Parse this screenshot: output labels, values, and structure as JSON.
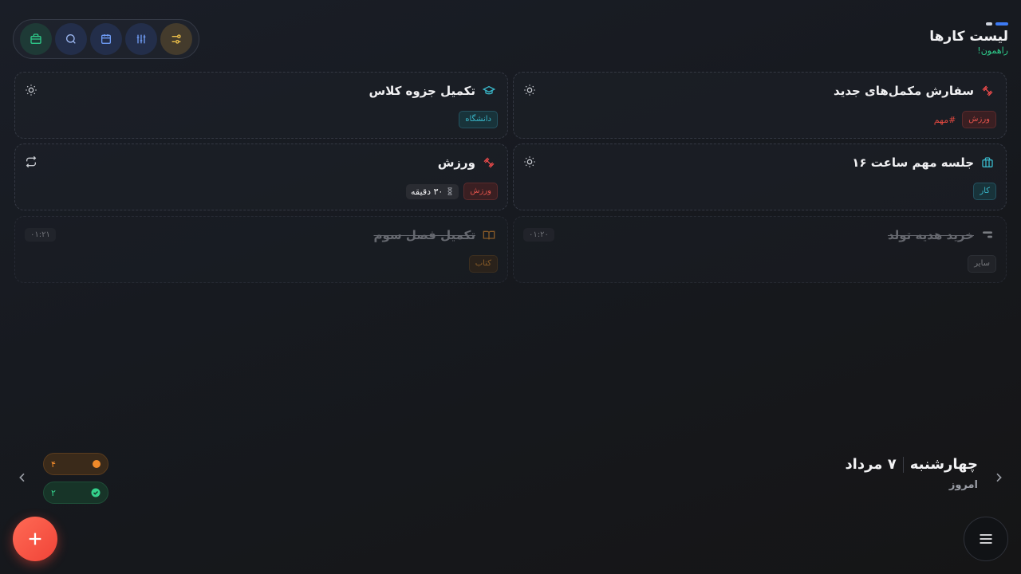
{
  "header": {
    "title": "لیست کارها",
    "subtitle": "راهمون!"
  },
  "toolbar": {
    "icons": [
      "briefcase-icon",
      "search-icon",
      "calendar-icon",
      "sliders-icon",
      "filter-toggle-icon"
    ]
  },
  "tasks": [
    {
      "title": "سفارش مکمل‌های جدید",
      "icon": "dumbbell-icon",
      "tags": [
        "ورزش"
      ],
      "hashtag": "#مهم",
      "action": "sun-icon"
    },
    {
      "title": "تکمیل جزوه کلاس",
      "icon": "graduation-cap-icon",
      "tags": [
        "دانشگاه"
      ],
      "action": "sun-icon"
    },
    {
      "title": "جلسه مهم ساعت ۱۶",
      "icon": "briefcase-icon",
      "tags": [
        "کار"
      ],
      "action": "sun-icon"
    },
    {
      "title": "ورزش",
      "icon": "dumbbell-icon",
      "tags": [
        "ورزش"
      ],
      "duration": "۳۰ دقیقه",
      "action": "repeat-icon"
    },
    {
      "title": "خرید هدیه تولد",
      "icon": "other-icon",
      "tags": [
        "سایر"
      ],
      "time": "۰۱:۲۰",
      "done": true
    },
    {
      "title": "تکمیل فصل سوم",
      "icon": "book-icon",
      "tags": [
        "کتاب"
      ],
      "time": "۰۱:۲۱",
      "done": true
    }
  ],
  "date": {
    "weekday": "چهارشنبه",
    "day": "۷ مرداد",
    "label": "امروز"
  },
  "stats": {
    "pending": "۴",
    "completed": "۲"
  },
  "colors": {
    "accent": "#3d7bf5",
    "green": "#2ecb8a",
    "red": "#f04438",
    "orange": "#f08a2a"
  }
}
